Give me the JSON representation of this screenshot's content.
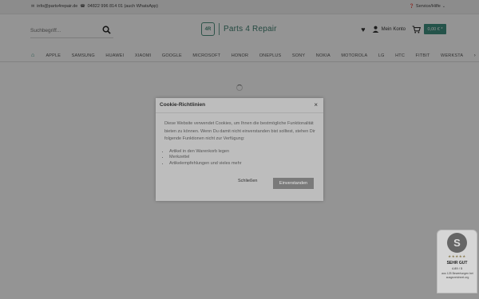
{
  "topbar": {
    "email": "info@parts4repair.de",
    "phone": "04822 996 814 01 (auch WhatsApp)",
    "service": "Service/Hilfe"
  },
  "header": {
    "search_placeholder": "Suchbegriff...",
    "logo_mark": "4R",
    "logo_text": "Parts 4 Repair",
    "account_label": "Mein Konto",
    "cart_total": "0,00 € *",
    "accent_color": "#3f8f80"
  },
  "nav": {
    "items": [
      "APPLE",
      "SAMSUNG",
      "HUAWEI",
      "XIAOMI",
      "GOOGLE",
      "MICROSOFT",
      "HONOR",
      "ONEPLUS",
      "SONY",
      "NOKIA",
      "MOTOROLA",
      "LG",
      "HTC",
      "FITBIT",
      "WERKSTA"
    ]
  },
  "modal": {
    "title": "Cookie-Richtlinien",
    "text": "Diese Website verwendet Cookies, um Ihnen die bestmögliche Funktionalität bieten zu können. Wenn Du damit nicht einverstanden bist solltest, stehen Dir folgende Funktionen nicht zur Verfügung:",
    "list": [
      "Artikel in den Warenkorb legen",
      "Merkzettel",
      "Artikelempfehlungen und vieles mehr"
    ],
    "close_label": "Schließen",
    "accept_label": "Einverstanden"
  },
  "badge": {
    "stars": "★★★★★",
    "rating_label": "SEHR GUT",
    "rating_value": "4.89 / 5",
    "reviews": "aus 125 Bewertungen bei ausgezeichnet.org"
  }
}
